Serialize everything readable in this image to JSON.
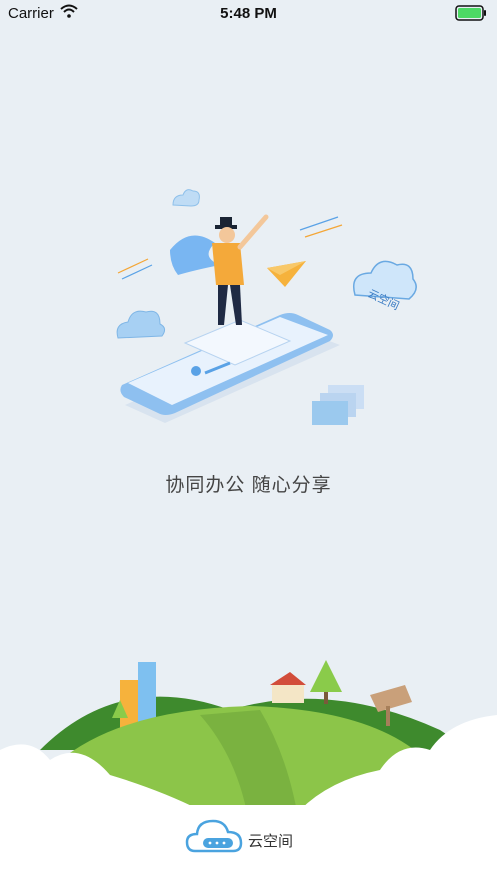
{
  "status_bar": {
    "carrier": "Carrier",
    "time": "5:48 PM",
    "battery_color": "#4cd964"
  },
  "illustration": {
    "cloud_label": "云空间"
  },
  "slogan": "协同办公 随心分享",
  "footer": {
    "app_name": "云空间",
    "logo_color": "#4aa3df"
  }
}
